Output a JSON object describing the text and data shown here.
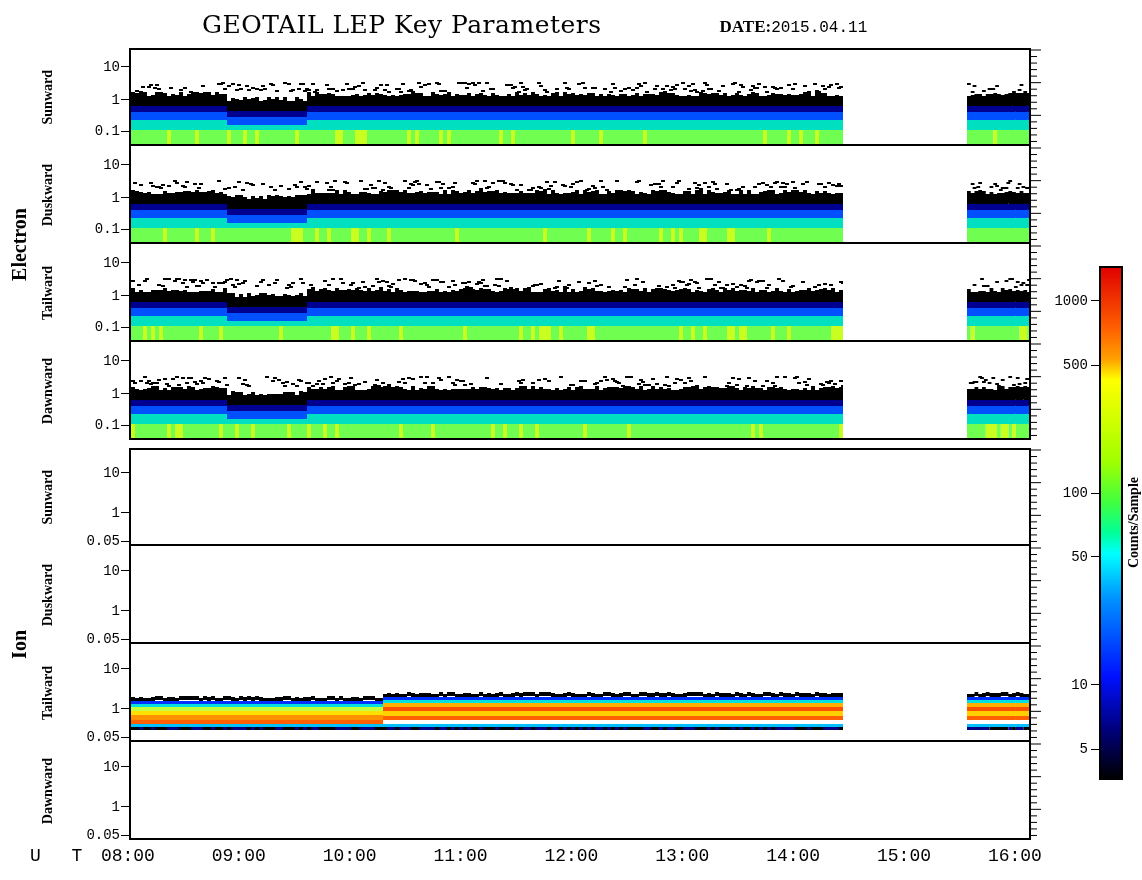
{
  "title": "GEOTAIL LEP Key Parameters",
  "date": "**DATE:**2015.04.11",
  "groups": [
    {
      "species": "Electron",
      "panels": [
        {
          "direction": "Sunward",
          "kind": "electron",
          "yticks": [
            "10",
            "1",
            "0.1"
          ]
        },
        {
          "direction": "Duskward",
          "kind": "electron",
          "yticks": [
            "10",
            "1",
            "0.1"
          ]
        },
        {
          "direction": "Tailward",
          "kind": "electron",
          "yticks": [
            "10",
            "1",
            "0.1"
          ]
        },
        {
          "direction": "Dawnward",
          "kind": "electron",
          "yticks": [
            "10",
            "1",
            "0.1"
          ]
        }
      ]
    },
    {
      "species": "Ion",
      "panels": [
        {
          "direction": "Sunward",
          "kind": "empty",
          "yticks": [
            "10",
            "1",
            "0.05"
          ]
        },
        {
          "direction": "Duskward",
          "kind": "empty",
          "yticks": [
            "10",
            "1",
            "0.05"
          ]
        },
        {
          "direction": "Tailward",
          "kind": "ion",
          "yticks": [
            "10",
            "1",
            "0.05"
          ]
        },
        {
          "direction": "Dawnward",
          "kind": "empty",
          "yticks": [
            "10",
            "1",
            "0.05"
          ]
        }
      ]
    }
  ],
  "colorbar": {
    "label": "Counts/Sample",
    "ticks": [
      "1000",
      "500",
      "100",
      "50",
      "10",
      "5"
    ]
  },
  "time_axis": {
    "label": "U T",
    "ticks": [
      "08:00",
      "09:00",
      "10:00",
      "11:00",
      "12:00",
      "13:00",
      "14:00",
      "15:00",
      "16:00"
    ]
  }
}
